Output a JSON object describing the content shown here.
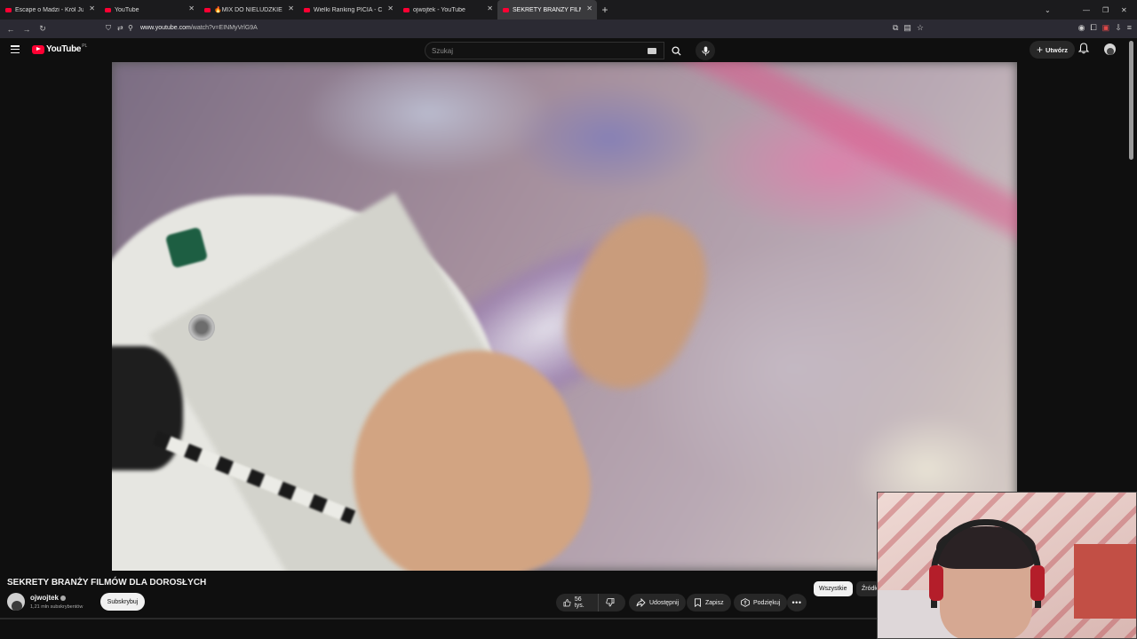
{
  "browser": {
    "tabs": [
      {
        "title": "Escape o Madzi - Król Julian & I",
        "active": false
      },
      {
        "title": "YouTube",
        "active": false
      },
      {
        "title": "🔥MIX DO NIELUDZKIEJ PRACY",
        "active": false
      },
      {
        "title": "Wielki Ranking PICIA - CZEGO I",
        "active": false
      },
      {
        "title": "ojwojtek - YouTube",
        "active": false
      },
      {
        "title": "SEKRETY BRANŻY FILMÓW DLA",
        "active": true
      }
    ],
    "url_host": "www.youtube.com",
    "url_path": "/watch?v=EINMyVrlG9A"
  },
  "youtube": {
    "logo_text": "YouTube",
    "logo_country": "PL",
    "search_placeholder": "Szukaj",
    "create_label": "Utwórz"
  },
  "video": {
    "title": "SEKRETY BRANŻY FILMÓW DLA DOROSŁYCH",
    "channel": "ojwojtek",
    "subscribers": "1,21 mln subskrybentów",
    "subscribe_label": "Subskrybuj",
    "likes": "56 tys.",
    "share_label": "Udostępnij",
    "save_label": "Zapisz",
    "thanks_label": "Podziękuj",
    "more_label": "•••"
  },
  "chips": {
    "all": "Wszystkie",
    "sources": "Źródło"
  },
  "colors": {
    "background": "#0f0f0f",
    "brand_red": "#ff0033",
    "pill": "#272727"
  }
}
